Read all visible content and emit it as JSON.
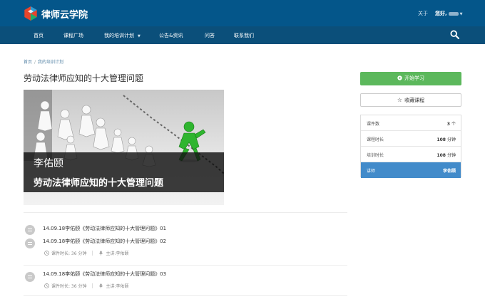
{
  "header": {
    "brand": "律师云学院",
    "about": "关于",
    "greeting": "您好,"
  },
  "nav": {
    "items": [
      "首页",
      "课程广场",
      "我的培训计划",
      "公告&资讯",
      "问答",
      "联系我们"
    ]
  },
  "breadcrumb": [
    "首页",
    "我的培训计划"
  ],
  "course": {
    "title": "劳动法律师应知的十大管理问题",
    "banner_teacher": "李佑颐",
    "banner_title": "劳动法律师应知的十大管理问题"
  },
  "lessons": [
    {
      "title": "14.09.18李佑颐《劳动法律师应知的十大管理问题》01"
    },
    {
      "title": "14.09.18李佑颐《劳动法律师应知的十大管理问题》02",
      "duration": "课件时长: 36 分钟",
      "lecturer": "主讲:李佑颐"
    },
    {
      "title": "14.09.18李佑颐《劳动法律师应知的十大管理问题》03",
      "duration": "课件时长: 36 分钟",
      "lecturer": "主讲:李佑颐"
    }
  ],
  "sidebar": {
    "start_button": "开始学习",
    "favorite_button": "收藏课程",
    "info": [
      {
        "label": "课件数",
        "value": "3",
        "unit": "个"
      },
      {
        "label": "课程时长",
        "value": "108",
        "unit": "分钟"
      },
      {
        "label": "培训时长",
        "value": "108",
        "unit": "分钟"
      },
      {
        "label": "讲师",
        "value": "李佑颐",
        "unit": ""
      }
    ]
  },
  "colors": {
    "header_bg": "#04568a",
    "nav_bg": "#0b4f7a",
    "start_green": "#5cb85c",
    "teacher_blue": "#428bca"
  },
  "icons": {
    "logo": "logo-icon",
    "search": "search-icon",
    "play": "play-circle-icon",
    "star": "star-outline-icon",
    "lesson": "list-circle-icon",
    "clock": "clock-icon",
    "mic": "microphone-icon"
  }
}
